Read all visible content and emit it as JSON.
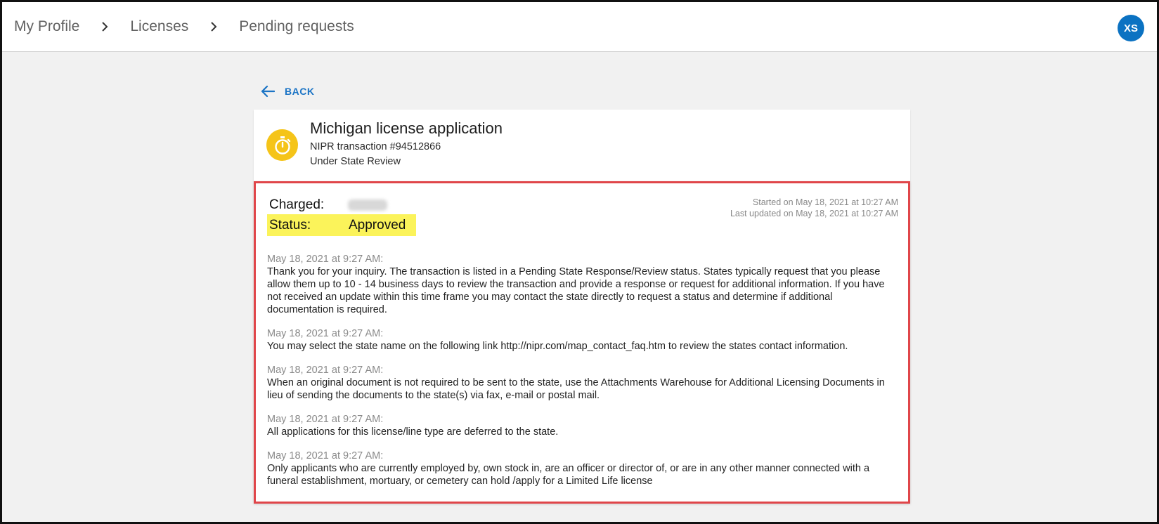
{
  "breadcrumb": {
    "items": [
      "My Profile",
      "Licenses",
      "Pending requests"
    ]
  },
  "user": {
    "initials": "XS"
  },
  "back": {
    "label": "BACK"
  },
  "application": {
    "title": "Michigan license application",
    "transaction": "NIPR transaction #94512866",
    "state": "Under State Review"
  },
  "details": {
    "charged_label": "Charged:",
    "status_label": "Status:",
    "status_value": "Approved",
    "started": "Started on May 18, 2021 at 10:27 AM",
    "updated": "Last updated on May 18, 2021 at 10:27 AM"
  },
  "notes": [
    {
      "time": "May 18, 2021 at 9:27 AM:",
      "text": "Thank you for your inquiry. The transaction is listed in a Pending State Response/Review status. States typically request that you please allow them up to 10 - 14 business days to review the transaction and provide a response or request for additional information. If you have not received an update within this time frame you may contact the state directly to request a status and determine if additional documentation is required."
    },
    {
      "time": "May 18, 2021 at 9:27 AM:",
      "text": "You may select the state name on the following link http://nipr.com/map_contact_faq.htm to review the states contact information."
    },
    {
      "time": "May 18, 2021 at 9:27 AM:",
      "text": "When an original document is not required to be sent to the state, use the Attachments Warehouse for Additional Licensing Documents in lieu of sending the documents to the state(s) via fax, e-mail or postal mail."
    },
    {
      "time": "May 18, 2021 at 9:27 AM:",
      "text": "All applications for this license/line type are deferred to the state."
    },
    {
      "time": "May 18, 2021 at 9:27 AM:",
      "text": "Only applicants who are currently employed by, own stock in, are an officer or director of, or are in any other manner connected with a funeral establishment, mortuary, or cemetery can hold /apply for a Limited Life license"
    }
  ],
  "colors": {
    "accent": "#1b74c5",
    "avatar": "#0b72c2",
    "status_badge": "#f5c419",
    "highlight": "#fbf35a",
    "annotation_border": "#e0464a"
  },
  "icons": {
    "breadcrumb_separator": "chevron-right-icon",
    "back": "arrow-left-icon",
    "status": "timer-icon"
  }
}
